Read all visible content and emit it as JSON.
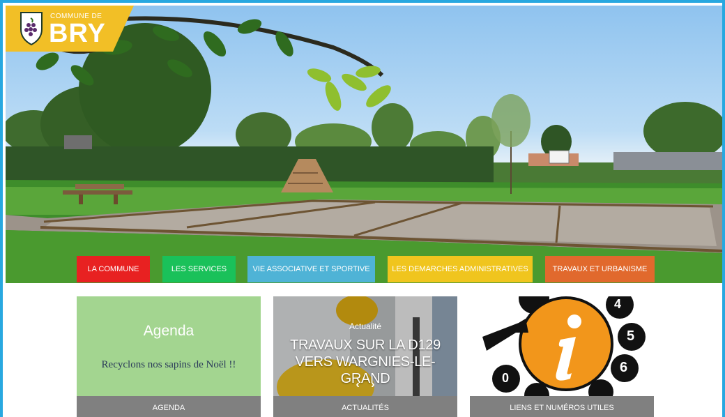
{
  "header": {
    "logo_small": "COMMUNE DE",
    "logo_big": "BRY"
  },
  "nav": [
    {
      "label": "LA COMMUNE",
      "color": "#e82121"
    },
    {
      "label": "LES SERVICES",
      "color": "#1ac15a"
    },
    {
      "label": "VIE ASSOCIATIVE ET SPORTIVE",
      "color": "#4fb3d6"
    },
    {
      "label": "LES DEMARCHES ADMINISTRATIVES",
      "color": "#f0c51e"
    },
    {
      "label": "TRAVAUX ET URBANISME",
      "color": "#e1692d"
    }
  ],
  "tiles": {
    "agenda": {
      "title": "Agenda",
      "item": "Recyclons nos sapins de Noël !!",
      "caption": "AGENDA",
      "color": "#a3d590"
    },
    "news": {
      "label": "Actualité",
      "title": "TRAVAUX SUR LA D129 VERS WARGNIES-LE-GRAND",
      "caption": "ACTUALITÉS",
      "prev": "‹",
      "next": "›"
    },
    "links": {
      "caption": "LIENS ET NUMÉROS UTILES",
      "icon_letter": "i",
      "digits": [
        "4",
        "5",
        "6",
        "0"
      ]
    }
  },
  "colors": {
    "frame_border": "#28a8e0",
    "logo": "#f2bf26",
    "caption_bg": "#808080"
  }
}
